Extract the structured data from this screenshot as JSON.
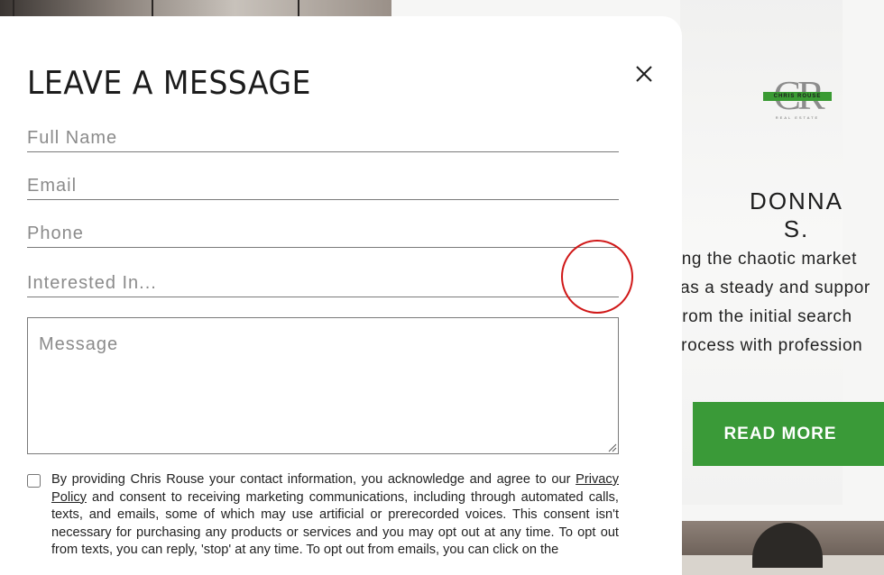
{
  "modal": {
    "title": "LEAVE A MESSAGE",
    "fields": {
      "full_name_placeholder": "Full Name",
      "email_placeholder": "Email",
      "phone_placeholder": "Phone",
      "interested_placeholder": "Interested In...",
      "message_placeholder": "Message"
    },
    "consent": {
      "checked": false,
      "text_before_link": "By providing Chris Rouse your contact information, you acknowledge and agree to our ",
      "link_label": "Privacy Policy",
      "text_after_link": " and consent to receiving marketing communications, including through automated calls, texts, and emails, some of which may use artificial or prerecorded voices. This consent isn't necessary for purchasing any products or services and you may opt out at any time. To opt out from texts, you can reply, 'stop' at any time. To opt out from emails, you can click on the"
    },
    "close_icon": "close-icon"
  },
  "background": {
    "logo": {
      "monogram": "CR",
      "band_text": "CHRIS ROUSE",
      "sub_text": "REAL ESTATE",
      "accent_color": "#3a9a33"
    },
    "testimonial": {
      "reviewer": "DONNA S.",
      "quote_lines": [
        "ring the chaotic market",
        "vas a steady and suppor",
        "From the initial search",
        "process with profession"
      ],
      "read_more_label": "READ MORE",
      "button_color": "#3a9a38"
    }
  },
  "colors": {
    "cursor_ring": "#d01818"
  }
}
